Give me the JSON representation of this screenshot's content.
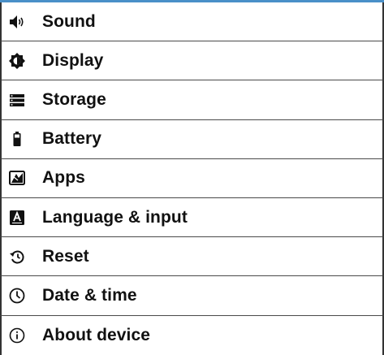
{
  "settings": {
    "items": [
      {
        "label": "Sound",
        "icon": "speaker-icon"
      },
      {
        "label": "Display",
        "icon": "brightness-icon"
      },
      {
        "label": "Storage",
        "icon": "storage-icon"
      },
      {
        "label": "Battery",
        "icon": "battery-icon"
      },
      {
        "label": "Apps",
        "icon": "apps-icon"
      },
      {
        "label": "Language & input",
        "icon": "keyboard-letter-icon"
      },
      {
        "label": "Reset",
        "icon": "restore-icon"
      },
      {
        "label": "Date & time",
        "icon": "clock-icon"
      },
      {
        "label": "About device",
        "icon": "info-icon"
      }
    ]
  },
  "colors": {
    "text": "#111111",
    "divider": "#4a4a4a",
    "accent": "#4a90c8"
  }
}
